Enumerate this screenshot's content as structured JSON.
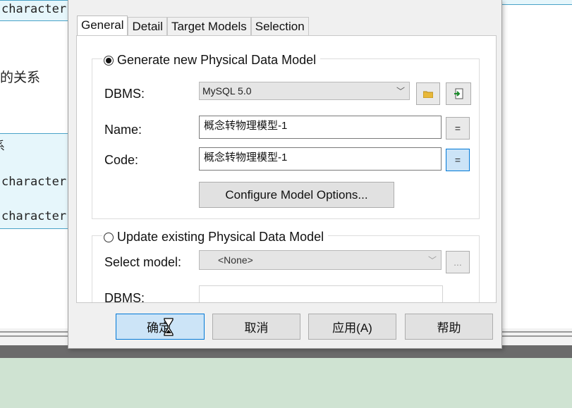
{
  "background": {
    "lines": [
      "character",
      "的关系",
      "系",
      "character",
      "character"
    ]
  },
  "dialog": {
    "tabs": [
      "General",
      "Detail",
      "Target Models",
      "Selection"
    ],
    "generate_option": {
      "label": "Generate new Physical Data Model",
      "selected": true,
      "dbms_label": "DBMS:",
      "dbms_value": "MySQL 5.0",
      "name_label": "Name:",
      "name_value": "概念转物理模型-1",
      "code_label": "Code:",
      "code_value": "概念转物理模型-1",
      "equals": "=",
      "configure_button": "Configure Model Options..."
    },
    "update_option": {
      "label": "Update existing Physical Data Model",
      "selected": false,
      "select_model_label": "Select model:",
      "select_model_value": "<None>",
      "ellipsis": "...",
      "dbms_label": "DBMS:"
    },
    "buttons": {
      "ok": "确定",
      "cancel": "取消",
      "apply": "应用(A)",
      "help": "帮助"
    }
  }
}
